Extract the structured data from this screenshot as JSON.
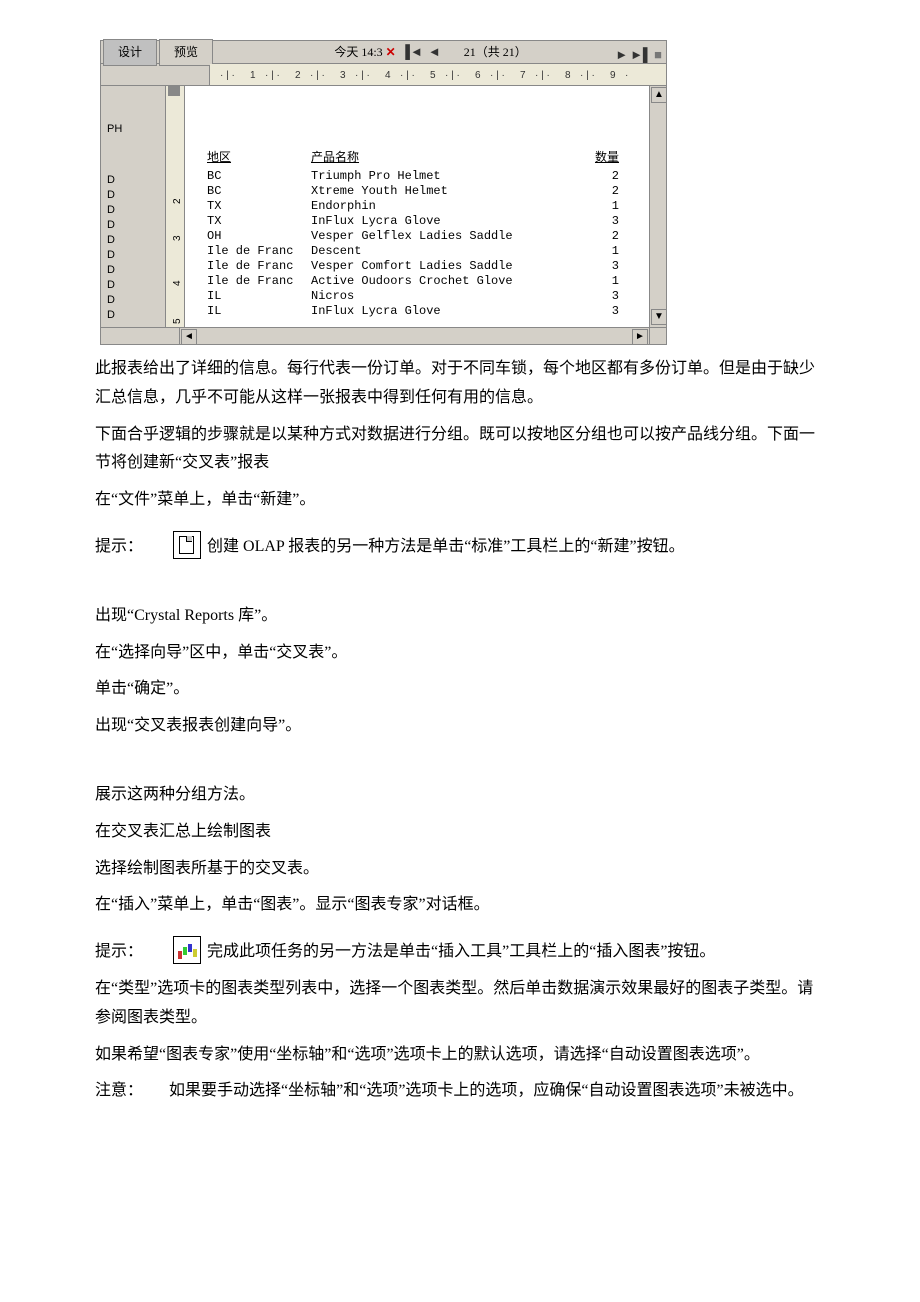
{
  "screenshot": {
    "tab_design": "设计",
    "tab_preview": "预览",
    "header_center": "今天   14:3",
    "page_counter": "21（共 21）",
    "ruler_ticks": [
      "1",
      "2",
      "3",
      "4",
      "5",
      "6",
      "7",
      "8",
      "9"
    ],
    "section_ph": "PH",
    "section_d": "D",
    "vruler": [
      "2",
      "3",
      "4",
      "5"
    ],
    "col_region": "地区",
    "col_product": "产品名称",
    "col_qty": "数量",
    "rows": [
      {
        "region": "BC",
        "product": "Triumph Pro Helmet",
        "qty": "2"
      },
      {
        "region": "BC",
        "product": "Xtreme Youth Helmet",
        "qty": "2"
      },
      {
        "region": "TX",
        "product": "Endorphin",
        "qty": "1"
      },
      {
        "region": "TX",
        "product": "InFlux Lycra Glove",
        "qty": "3"
      },
      {
        "region": "OH",
        "product": "Vesper Gelflex Ladies Saddle",
        "qty": "2"
      },
      {
        "region": "Ile de Franc",
        "product": "Descent",
        "qty": "1"
      },
      {
        "region": "Ile de Franc",
        "product": "Vesper Comfort Ladies Saddle",
        "qty": "3"
      },
      {
        "region": "Ile de Franc",
        "product": "Active Oudoors Crochet Glove",
        "qty": "1"
      },
      {
        "region": "IL",
        "product": "Nicros",
        "qty": "3"
      },
      {
        "region": "IL",
        "product": "InFlux Lycra Glove",
        "qty": "3"
      }
    ]
  },
  "body": {
    "p1": "此报表给出了详细的信息。每行代表一份订单。对于不同车锁，每个地区都有多份订单。但是由于缺少汇总信息，几乎不可能从这样一张报表中得到任何有用的信息。",
    "p2": "下面合乎逻辑的步骤就是以某种方式对数据进行分组。既可以按地区分组也可以按产品线分组。下面一节将创建新“交叉表”报表",
    "p3": "在“文件”菜单上，单击“新建”。",
    "tip1_label": "提示：",
    "tip1_text": "创建 OLAP 报表的另一种方法是单击“标准”工具栏上的“新建”按钮。",
    "p4": "出现“Crystal Reports 库”。",
    "p5": "在“选择向导”区中，单击“交叉表”。",
    "p6": "单击“确定”。",
    "p7": "出现“交叉表报表创建向导”。",
    "p8": "展示这两种分组方法。",
    "p9": "在交叉表汇总上绘制图表",
    "p10": "选择绘制图表所基于的交叉表。",
    "p11": "在“插入”菜单上，单击“图表”。显示“图表专家”对话框。",
    "tip2_label": "提示：",
    "tip2_text": "完成此项任务的另一方法是单击“插入工具”工具栏上的“插入图表”按钮。",
    "p12": "在“类型”选项卡的图表类型列表中，选择一个图表类型。然后单击数据演示效果最好的图表子类型。请参阅图表类型。",
    "p13": "如果希望“图表专家”使用“坐标轴”和“选项”选项卡上的默认选项，请选择“自动设置图表选项”。",
    "note_label": "注意：",
    "note_text": "如果要手动选择“坐标轴”和“选项”选项卡上的选项，应确保“自动设置图表选项”未被选中。"
  }
}
